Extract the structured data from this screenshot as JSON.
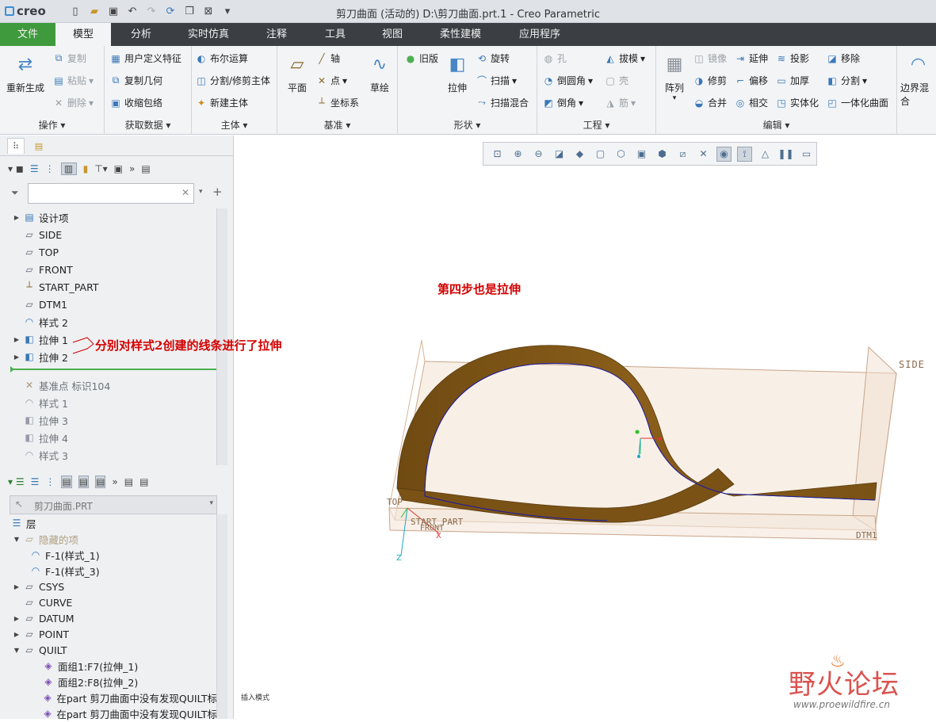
{
  "app": {
    "logo": "creo",
    "title": "剪刀曲面 (活动的) D:\\剪刀曲面.prt.1 - Creo Parametric",
    "qat_icons": [
      "new-icon",
      "open-icon",
      "save-icon",
      "undo-icon",
      "redo-icon",
      "regenerate-icon",
      "window-icon",
      "close-window-icon",
      "customize-icon"
    ]
  },
  "tabs": [
    "文件",
    "模型",
    "分析",
    "实时仿真",
    "注释",
    "工具",
    "视图",
    "柔性建模",
    "应用程序"
  ],
  "ribbon": {
    "operations": {
      "title": "操作",
      "regenerate": "重新生成",
      "copy": "复制",
      "paste": "粘贴",
      "delete": "删除"
    },
    "getdata": {
      "title": "获取数据",
      "udf": "用户定义特征",
      "copy_geom": "复制几何",
      "shrinkwrap": "收缩包络"
    },
    "body": {
      "title": "主体",
      "boolean": "布尔运算",
      "split_trim": "分割/修剪主体",
      "new_body": "新建主体"
    },
    "datum": {
      "title": "基准",
      "plane": "平面",
      "axis": "轴",
      "point": "点",
      "csys": "坐标系",
      "sketch": "草绘"
    },
    "shapes": {
      "title": "形状",
      "legacy": "旧版",
      "extrude": "拉伸",
      "revolve": "旋转",
      "sweep": "扫描",
      "swept_blend": "扫描混合"
    },
    "engineering": {
      "title": "工程",
      "hole": "孔",
      "round": "倒圆角",
      "chamfer": "倒角",
      "draft": "拔模",
      "shell": "壳",
      "rib": "筋"
    },
    "editing": {
      "title": "编辑",
      "pattern": "阵列",
      "mirror": "镜像",
      "trim": "修剪",
      "merge": "合并",
      "extend": "延伸",
      "offset": "偏移",
      "intersect": "相交",
      "project": "投影",
      "thicken": "加厚",
      "solidify": "实体化",
      "remove": "移除",
      "split": "分割",
      "unify": "一体化曲面"
    },
    "surfaces": {
      "boundary_blend": "边界混合"
    }
  },
  "model_tree": {
    "filter_placeholder": "",
    "items": [
      {
        "label": "设计项",
        "icon": "design-items-icon",
        "state": "normal"
      },
      {
        "label": "SIDE",
        "icon": "plane-icon",
        "state": "normal"
      },
      {
        "label": "TOP",
        "icon": "plane-icon",
        "state": "normal"
      },
      {
        "label": "FRONT",
        "icon": "plane-icon",
        "state": "normal"
      },
      {
        "label": "START_PART",
        "icon": "csys-icon",
        "state": "normal"
      },
      {
        "label": "DTM1",
        "icon": "plane-icon",
        "state": "normal"
      },
      {
        "label": "样式 2",
        "icon": "style-icon",
        "state": "normal"
      },
      {
        "label": "拉伸 1",
        "icon": "extrude-icon",
        "state": "normal"
      },
      {
        "label": "拉伸 2",
        "icon": "extrude-icon",
        "state": "normal"
      },
      {
        "label": "基准点 标识104",
        "icon": "datum-point-icon",
        "state": "suppressed"
      },
      {
        "label": "样式 1",
        "icon": "style-icon",
        "state": "suppressed"
      },
      {
        "label": "拉伸 3",
        "icon": "extrude-icon",
        "state": "suppressed"
      },
      {
        "label": "拉伸 4",
        "icon": "extrude-icon",
        "state": "suppressed"
      },
      {
        "label": "样式 3",
        "icon": "style-icon",
        "state": "suppressed"
      }
    ]
  },
  "layer_tree": {
    "model": "剪刀曲面.PRT",
    "root": "层",
    "items": [
      {
        "label": "隐藏的项",
        "level": 1,
        "state": "faded"
      },
      {
        "label": "F-1(样式_1)",
        "level": 2,
        "state": "normal"
      },
      {
        "label": "F-1(样式_3)",
        "level": 2,
        "state": "normal"
      },
      {
        "label": "CSYS",
        "level": 1,
        "state": "normal"
      },
      {
        "label": "CURVE",
        "level": 1,
        "state": "normal"
      },
      {
        "label": "DATUM",
        "level": 1,
        "state": "normal"
      },
      {
        "label": "POINT",
        "level": 1,
        "state": "normal"
      },
      {
        "label": "QUILT",
        "level": 1,
        "state": "normal"
      },
      {
        "label": "面组1:F7(拉伸_1)",
        "level": 2,
        "state": "normal"
      },
      {
        "label": "面组2:F8(拉伸_2)",
        "level": 2,
        "state": "normal"
      },
      {
        "label": "在part 剪刀曲面中没有发现QUILT标",
        "level": 2,
        "state": "normal"
      },
      {
        "label": "在part 剪刀曲面中没有发现QUILT标",
        "level": 2,
        "state": "normal"
      }
    ]
  },
  "annotations": {
    "step": "第四步也是拉伸",
    "extrude_note": "分别对样式2创建的线条进行了拉伸"
  },
  "viewport": {
    "labels": {
      "side": "SIDE",
      "top": "TOP",
      "front": "FRONT",
      "start_part": "START_PART",
      "dtm1": "DTM1",
      "axis_x": "X",
      "axis_z": "Z"
    },
    "status": "插入模式"
  },
  "watermark": {
    "name": "野火论坛",
    "url": "www.proewildfire.cn"
  }
}
